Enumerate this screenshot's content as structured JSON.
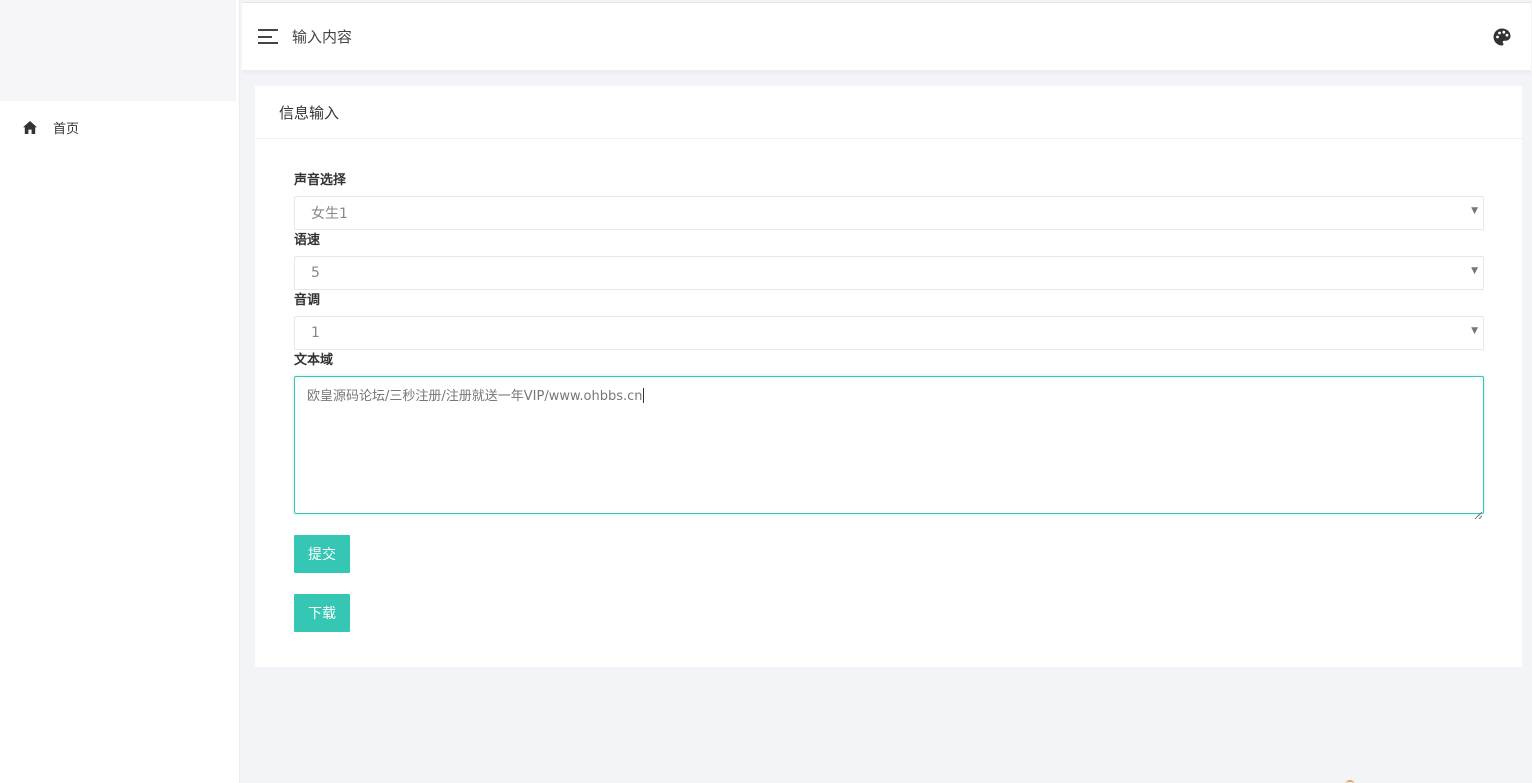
{
  "sidebar": {
    "items": [
      {
        "label": "首页",
        "icon": "home-icon"
      }
    ]
  },
  "header": {
    "title": "输入内容",
    "menu_icon": "hamburger-icon",
    "theme_icon": "palette-icon"
  },
  "card": {
    "title": "信息输入"
  },
  "form": {
    "voice": {
      "label": "声音选择",
      "value": "女生1"
    },
    "speed": {
      "label": "语速",
      "value": "5"
    },
    "pitch": {
      "label": "音调",
      "value": "1"
    },
    "text": {
      "label": "文本域",
      "value": "欧皇源码论坛/三秒注册/注册就送一年VIP/www.ohbbs.cn"
    },
    "submit_label": "提交",
    "download_label": "下载"
  },
  "colors": {
    "accent": "#36c6b4",
    "background": "#f3f4f8"
  }
}
